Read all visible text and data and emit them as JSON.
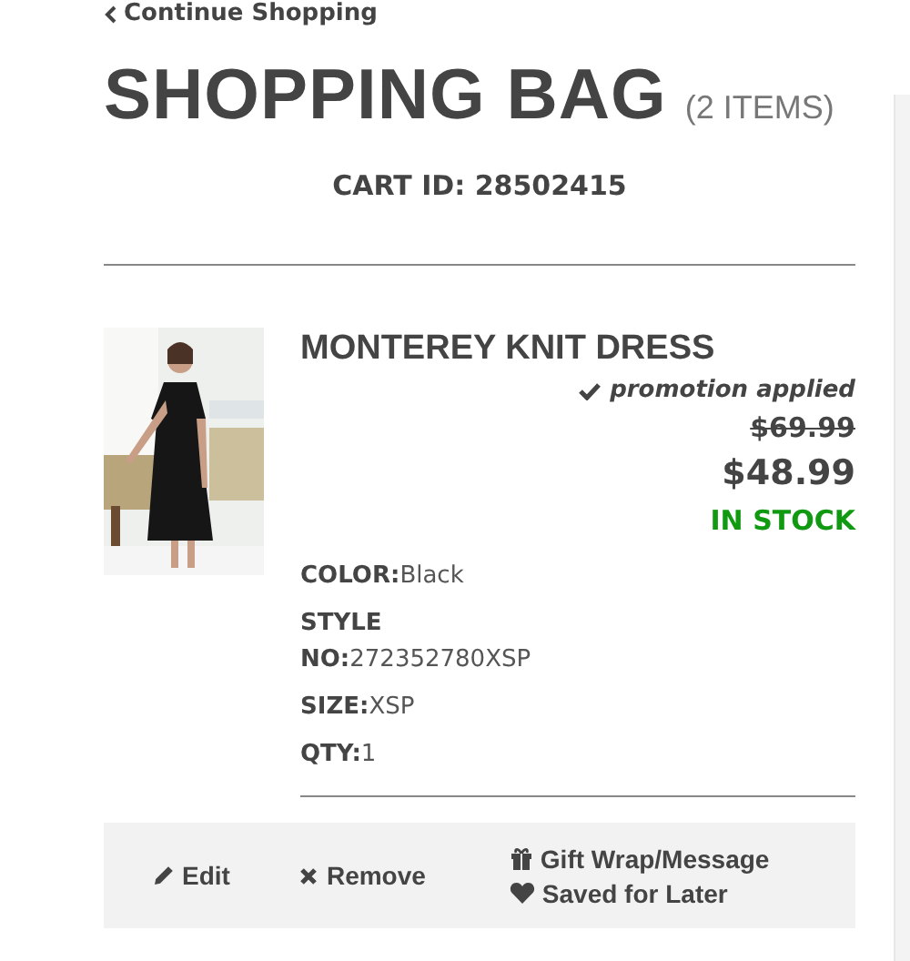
{
  "back_link": {
    "label": "Continue Shopping"
  },
  "header": {
    "title": "SHOPPING BAG",
    "count": "(2 ITEMS)",
    "cart_id": "CART ID: 28502415"
  },
  "item": {
    "name": "MONTEREY KNIT DRESS",
    "promotion": "promotion applied",
    "original_price": "$69.99",
    "price": "$48.99",
    "stock": "IN STOCK",
    "attributes": [
      {
        "label": "COLOR:",
        "value": "Black"
      },
      {
        "label": "STYLE NO:",
        "value": "272352780XSP"
      },
      {
        "label": "SIZE:",
        "value": "XSP"
      },
      {
        "label": "QTY:",
        "value": "1"
      }
    ]
  },
  "actions": [
    {
      "kind": "edit",
      "label": "Edit"
    },
    {
      "kind": "remove",
      "label": "Remove"
    },
    {
      "kind": "gift",
      "label": "Gift Wrap/Message"
    },
    {
      "kind": "saved",
      "label": "Saved for Later"
    }
  ]
}
